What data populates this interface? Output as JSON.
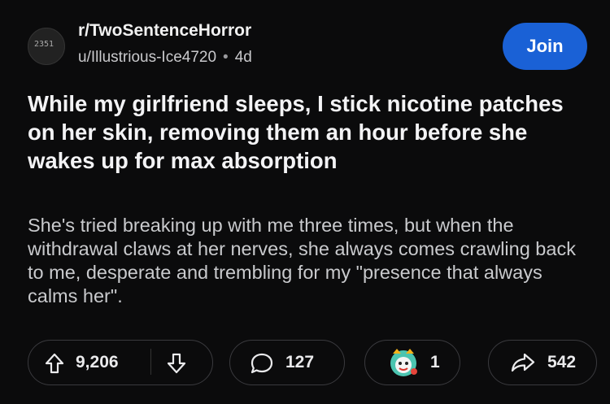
{
  "post": {
    "subreddit": "r/TwoSentenceHorror",
    "author": "u/Illustrious-Ice4720",
    "time_separator": "•",
    "age": "4d",
    "join_label": "Join",
    "avatar_text": "2351",
    "title": "While my girlfriend sleeps, I stick nicotine patches on her skin, removing them an hour before she wakes up for max absorption",
    "body": "She's tried breaking up with me three times, but when the withdrawal claws at her nerves, she always comes crawling back to me, desperate and trembling for my \"presence that always calms her\"."
  },
  "actions": {
    "upvotes": "9,206",
    "comments": "127",
    "awards": "1",
    "shares": "542"
  },
  "icons": {
    "upvote": "arrow-up-icon",
    "downvote": "arrow-down-icon",
    "comment": "comment-bubble-icon",
    "award": "award-icon",
    "share": "share-arrow-icon"
  },
  "colors": {
    "background": "#0b0b0c",
    "join": "#1a61d6",
    "text": "#e8e8ea"
  }
}
